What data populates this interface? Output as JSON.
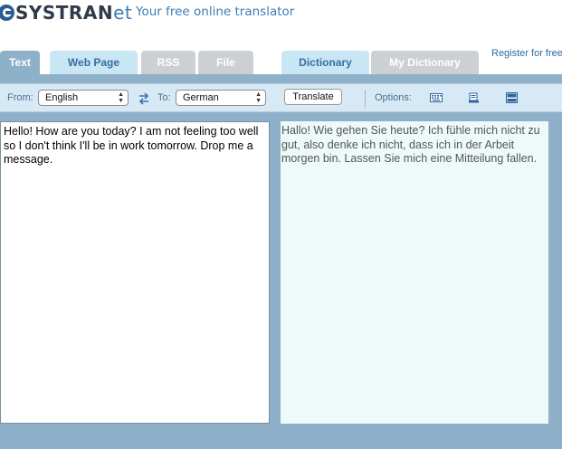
{
  "header": {
    "logo_main": "SYSTRAN",
    "logo_suffix": "et",
    "tagline": "Your free online translator",
    "register_link": "Register for free"
  },
  "tabs": {
    "left": [
      {
        "label": "Text",
        "state": "active"
      },
      {
        "label": "Web Page",
        "state": "enabled"
      },
      {
        "label": "RSS",
        "state": "disabled"
      },
      {
        "label": "File",
        "state": "disabled"
      }
    ],
    "right": [
      {
        "label": "Dictionary",
        "state": "enabled"
      },
      {
        "label": "My Dictionary",
        "state": "disabled"
      }
    ]
  },
  "toolbar": {
    "from_label": "From:",
    "from_value": "English",
    "to_label": "To:",
    "to_value": "German",
    "translate_button": "Translate",
    "options_label": "Options:",
    "option_icons": [
      "keyboard-icon",
      "print-icon",
      "layout-icon"
    ]
  },
  "source_text": "Hello! How are you today? I am not feeling too well so I don't think I'll be in work tomorrow. Drop me a message.",
  "translated_text": "Hallo! Wie gehen Sie heute? Ich fühle mich nicht zu gut, also denke ich nicht, dass ich in der Arbeit morgen bin. Lassen Sie mich eine Mitteilung fallen.",
  "colors": {
    "panel_bg": "#8fb0c9",
    "toolbar_bg": "#d8e9f6",
    "active_tab": "#8fb0c9",
    "enabled_tab": "#c9e6f4",
    "disabled_tab": "#cdd0d3",
    "brand_blue": "#3d7db5",
    "output_bg": "#eefaf9"
  }
}
